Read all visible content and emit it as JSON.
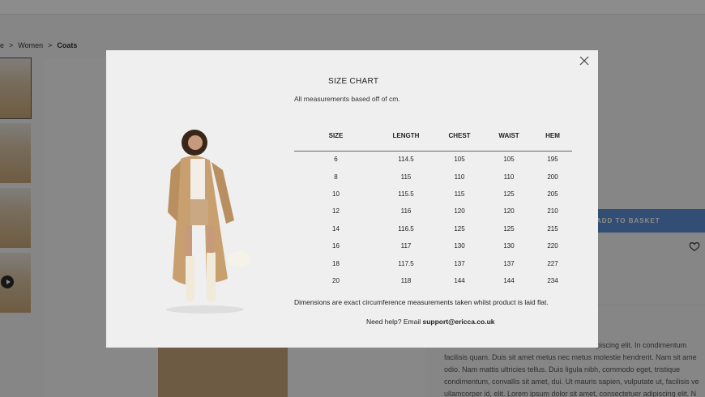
{
  "breadcrumb": {
    "sep1": ">",
    "parent": "Women",
    "sep2": ">",
    "current": "Coats",
    "first": "e"
  },
  "product": {
    "basket_label": "ADD TO BASKET",
    "description_lines": [
      "ipiscing elit. In condimentum",
      "facilisis quam. Duis sit amet metus nec metus molestie hendrerit. Nam sit ame",
      "odio. Nam mattis ultricies tellus. Duis ligula nibh, commodo eget, tristique",
      "condimentum, convallis sit amet, dui. Ut mauris sapien, vulputate ut, facilisis ve",
      "ullamcorper id, elit. Lorem ipsum dolor sit amet, consectetuer adipiscing elit. N"
    ]
  },
  "modal": {
    "title": "SIZE CHART",
    "subtitle": "All measurements based off of cm.",
    "columns": [
      "SIZE",
      "LENGTH",
      "CHEST",
      "WAIST",
      "HEM"
    ],
    "rows": [
      [
        "6",
        "114.5",
        "105",
        "105",
        "195"
      ],
      [
        "8",
        "115",
        "110",
        "110",
        "200"
      ],
      [
        "10",
        "115.5",
        "115",
        "125",
        "205"
      ],
      [
        "12",
        "116",
        "120",
        "120",
        "210"
      ],
      [
        "14",
        "116.5",
        "125",
        "125",
        "215"
      ],
      [
        "16",
        "117",
        "130",
        "130",
        "220"
      ],
      [
        "18",
        "117.5",
        "137",
        "137",
        "227"
      ],
      [
        "20",
        "118",
        "144",
        "144",
        "234"
      ]
    ],
    "note": "Dimensions are exact circumference measurements taken whilst product is laid flat.",
    "help_prefix": "Need help? Email ",
    "help_email": "support@ericca.co.uk"
  },
  "colors": {
    "accent": "#5b8ed6",
    "modal_bg": "#efefef",
    "overlay": "rgba(0,0,0,0.45)"
  }
}
